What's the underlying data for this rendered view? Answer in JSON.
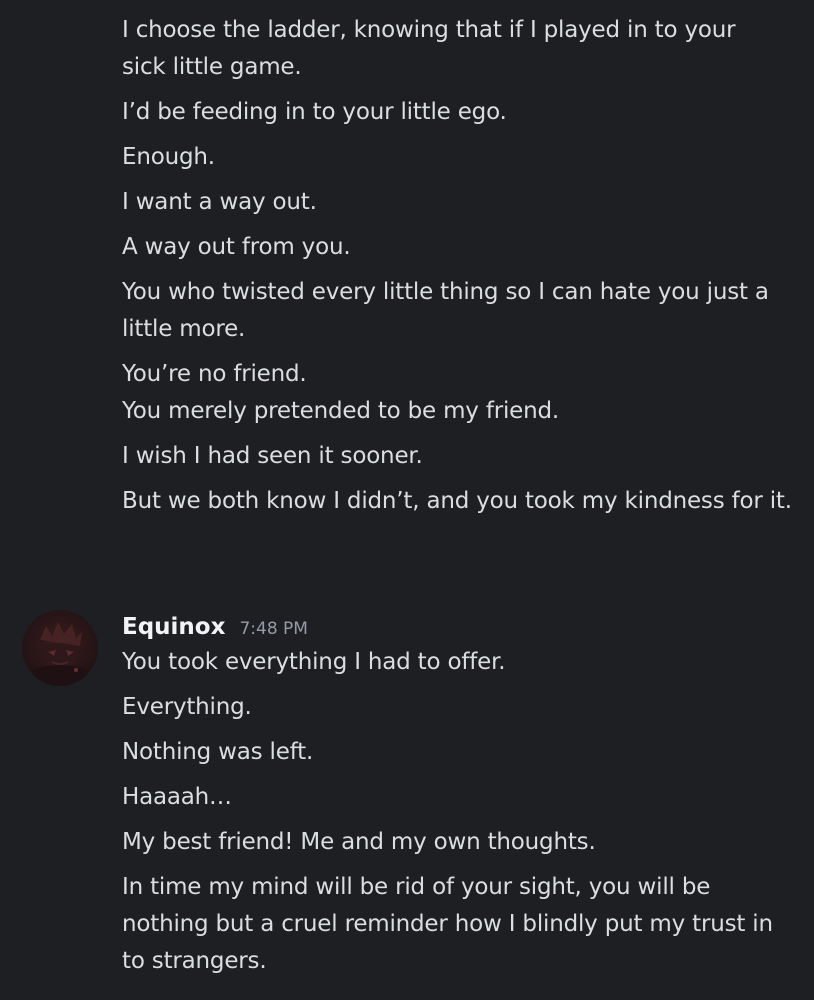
{
  "messages_continued": [
    "I choose the ladder, knowing that if I played in to your sick little game.",
    "I’d be feeding in to your little ego.",
    "Enough.",
    "I want a way out.",
    "A way out from you.",
    "You who twisted every little thing so I can hate you just a little more.",
    "You’re no friend.",
    "You merely pretended to be my friend.",
    "I wish I had seen it sooner.",
    "But we both know I didn’t, and you took my kindness for it."
  ],
  "author_group": {
    "author": "Equinox",
    "timestamp": "7:48 PM",
    "avatar_icon": "avatar-image",
    "messages": [
      "You took everything I had to offer.",
      "Everything.",
      "Nothing was left.",
      "Haaaah…",
      "My best friend! Me and my own thoughts.",
      "In time my mind will be rid of your sight, you will be nothing but a cruel reminder how I blindly put my trust in to strangers."
    ]
  },
  "colors": {
    "background": "#1e1f22",
    "text": "#dbdee1",
    "author": "#f2f3f5",
    "timestamp": "#949ba4"
  }
}
